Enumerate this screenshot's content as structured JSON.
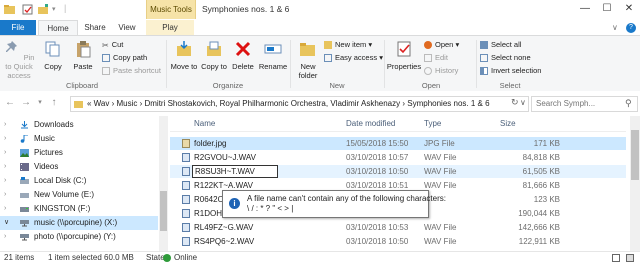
{
  "window": {
    "title": "Symphonies nos. 1 & 6",
    "context_tab_group": "Music Tools",
    "minimize": "—",
    "maximize": "☐",
    "close": "✕",
    "help": "?"
  },
  "tabs": {
    "file": "File",
    "home": "Home",
    "share": "Share",
    "view": "View",
    "play": "Play"
  },
  "ribbon": {
    "clipboard": {
      "label": "Clipboard",
      "pin": "Pin to Quick access",
      "copy": "Copy",
      "paste": "Paste",
      "cut": "Cut",
      "copy_path": "Copy path",
      "paste_shortcut": "Paste shortcut"
    },
    "organize": {
      "label": "Organize",
      "move_to": "Move to",
      "copy_to": "Copy to",
      "delete": "Delete",
      "rename": "Rename"
    },
    "new": {
      "label": "New",
      "new_folder": "New folder",
      "new_item": "New item",
      "easy_access": "Easy access"
    },
    "open": {
      "label": "Open",
      "properties": "Properties",
      "open": "Open",
      "edit": "Edit",
      "history": "History"
    },
    "select": {
      "label": "Select",
      "select_all": "Select all",
      "select_none": "Select none",
      "invert_selection": "Invert selection"
    }
  },
  "address": {
    "path": "« Wav › Music › Dmitri Shostakovich, Royal Philharmonic Orchestra, Vladimir Askhenazy › Symphonies nos. 1 & 6",
    "search_placeholder": "Search Symph..."
  },
  "nav": {
    "items": [
      {
        "label": "Downloads"
      },
      {
        "label": "Music"
      },
      {
        "label": "Pictures"
      },
      {
        "label": "Videos"
      },
      {
        "label": "Local Disk (C:)"
      },
      {
        "label": "New Volume (E:)"
      },
      {
        "label": "KINGSTON (F:)"
      },
      {
        "label": "music (\\\\porcupine) (X:)"
      },
      {
        "label": "photo (\\\\porcupine) (Y:)"
      }
    ]
  },
  "columns": {
    "name": "Name",
    "date": "Date modified",
    "type": "Type",
    "size": "Size"
  },
  "files": [
    {
      "name": "folder.jpg",
      "date": "15/05/2018 15:50",
      "type": "JPG File",
      "size": "171 KB"
    },
    {
      "name": "R2GVOU~J.WAV",
      "date": "03/10/2018 10:57",
      "type": "WAV File",
      "size": "84,818 KB"
    },
    {
      "name": "R8SU3H~T.WAV",
      "date": "03/10/2018 10:50",
      "type": "WAV File",
      "size": "61,505 KB"
    },
    {
      "name": "R122KT~A.WAV",
      "date": "03/10/2018 10:51",
      "type": "WAV File",
      "size": "81,666 KB"
    },
    {
      "name": "R0642O",
      "date": "",
      "type": "",
      "size": "123 KB"
    },
    {
      "name": "R1DOH",
      "date": "",
      "type": "",
      "size": "190,044 KB"
    },
    {
      "name": "RL49FZ~G.WAV",
      "date": "03/10/2018 10:53",
      "type": "WAV File",
      "size": "142,666 KB"
    },
    {
      "name": "RS4PQ6~2.WAV",
      "date": "03/10/2018 10:50",
      "type": "WAV File",
      "size": "122,911 KB"
    }
  ],
  "rename_value": "R8SU3H~T.WAV",
  "tooltip": {
    "line1": "A file name can't contain any of the following characters:",
    "line2": "\\ / : * ? \" < > |"
  },
  "status": {
    "items": "21 items",
    "selected": "1 item selected  60.0 MB",
    "state_label": "State:",
    "state_value": "Online"
  }
}
